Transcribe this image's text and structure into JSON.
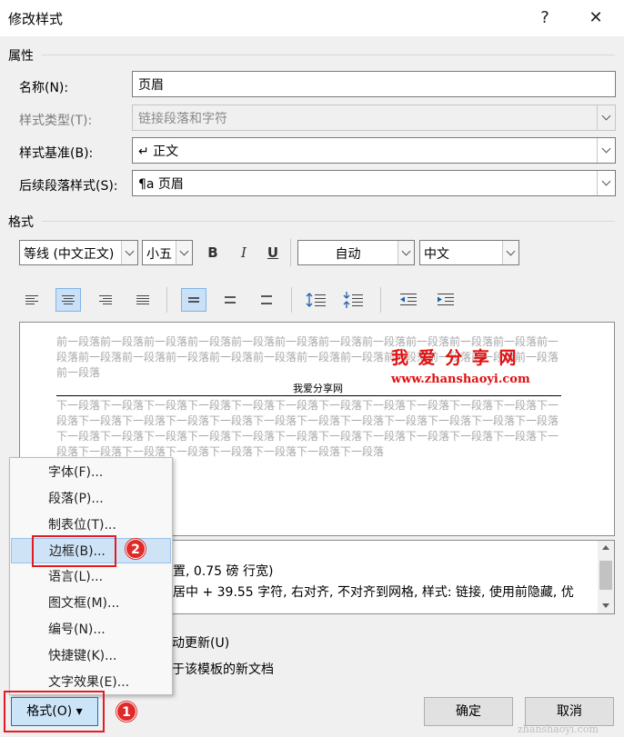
{
  "window": {
    "title": "修改样式",
    "help": "?",
    "close": "✕"
  },
  "properties": {
    "section": "属性",
    "name_label": "名称(N):",
    "name_value": "页眉",
    "type_label": "样式类型(T):",
    "type_value": "链接段落和字符",
    "based_label": "样式基准(B):",
    "based_value": "↵ 正文",
    "next_label": "后续段落样式(S):",
    "next_value": "¶a 页眉"
  },
  "format": {
    "section": "格式",
    "font": "等线 (中文正文)",
    "size": "小五",
    "bold": "B",
    "italic": "I",
    "underline": "U",
    "color": "自动",
    "language": "中文"
  },
  "preview": {
    "prev_para": "前一段落前一段落前一段落前一段落前一段落前一段落前一段落前一段落前一段落前一段落前一段落前一段落前一段落前一段落前一段落前一段落前一段落前一段落前一段落前一段落前一段落前一段落前一段落前一段落",
    "sample": "我爱分享网",
    "next_para": "下一段落下一段落下一段落下一段落下一段落下一段落下一段落下一段落下一段落下一段落下一段落下一段落下一段落下一段落下一段落下一段落下一段落下一段落下一段落下一段落下一段落下一段落下一段落下一段落下一段落下一段落下一段落下一段落下一段落下一段落下一段落下一段落下一段落下一段落下一段落下一段落下一段落下一段落下一段落下一段落下一段落下一段落",
    "watermark_title": "我 爱 分 享 网",
    "watermark_url": "www.zhanshaoyi.com"
  },
  "description": {
    "line1": "置, 0.75 磅 行宽)",
    "line2": "居中 +  39.55 字符, 右对齐, 不对齐到网格, 样式: 链接, 使用前隐藏, 优"
  },
  "options": {
    "auto_update": "动更新(U)",
    "new_docs": "于该模板的新文档"
  },
  "menu": {
    "items": [
      {
        "label": "字体(F)..."
      },
      {
        "label": "段落(P)..."
      },
      {
        "label": "制表位(T)..."
      },
      {
        "label": "边框(B)..."
      },
      {
        "label": "语言(L)..."
      },
      {
        "label": "图文框(M)..."
      },
      {
        "label": "编号(N)..."
      },
      {
        "label": "快捷键(K)..."
      },
      {
        "label": "文字效果(E)..."
      }
    ]
  },
  "buttons": {
    "format": "格式(O) ▾",
    "ok": "确定",
    "cancel": "取消"
  },
  "annotations": {
    "badge1": "1",
    "badge2": "2"
  },
  "site_footer": "zhanshaoyi.com",
  "colors": {
    "accent": "#0078d7",
    "annotation_red": "#e51b23",
    "highlight": "#cfe3f6"
  }
}
